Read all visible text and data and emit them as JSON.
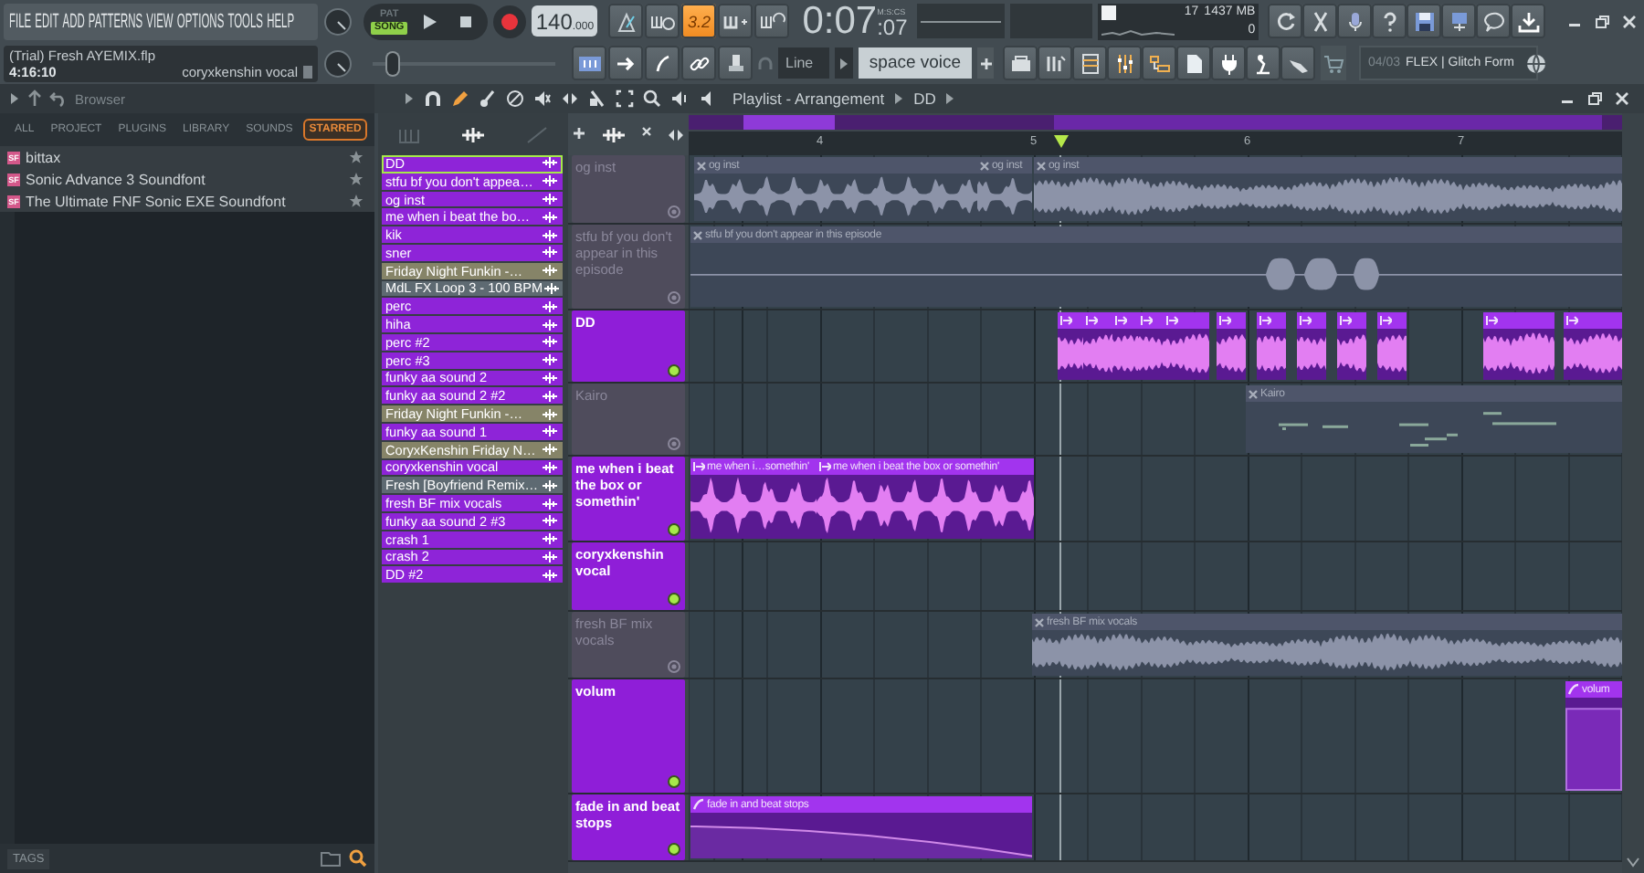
{
  "menu": [
    "FILE",
    "EDIT",
    "ADD",
    "PATTERNS",
    "VIEW",
    "OPTIONS",
    "TOOLS",
    "HELP"
  ],
  "transport": {
    "modes": [
      {
        "label": "PAT",
        "selected": false
      },
      {
        "label": "SONG",
        "selected": true
      }
    ]
  },
  "tempo": {
    "value": "140",
    "fraction": ".000"
  },
  "countdown": {
    "label": "3.2",
    "on": true
  },
  "time": {
    "display": "0:07",
    "centis": ":07",
    "unit": "M:S:CS"
  },
  "monitor": {
    "readings": [
      "17",
      "1437 MB",
      "0"
    ]
  },
  "hint": {
    "title": "(Trial) Fresh AYEMIX.flp",
    "position": "4:16:10",
    "channel": "coryxkenshin vocal"
  },
  "pitch": {
    "level": 0.08
  },
  "snap": {
    "value": "Line"
  },
  "pattern": {
    "value": "space voice"
  },
  "news": {
    "date": "04/03",
    "headline": "FLEX | Glitch Form"
  },
  "browser": {
    "title": "Browser",
    "tabs": [
      {
        "label": "ALL",
        "selected": false
      },
      {
        "label": "PROJECT",
        "selected": false
      },
      {
        "label": "PLUGINS",
        "selected": false
      },
      {
        "label": "LIBRARY",
        "selected": false
      },
      {
        "label": "SOUNDS",
        "selected": false
      },
      {
        "label": "STARRED",
        "selected": true
      }
    ],
    "items": [
      {
        "badge": "SF",
        "name": "bittax",
        "starred": true
      },
      {
        "badge": "SF",
        "name": "Sonic Advance 3 Soundfont",
        "starred": true
      },
      {
        "badge": "SF",
        "name": "The Ultimate FNF Sonic EXE Soundfont",
        "starred": true
      }
    ],
    "footer": "TAGS"
  },
  "playlist": {
    "title": "Playlist - Arrangement",
    "crumbs": [
      "DD"
    ],
    "channels": [
      {
        "name": "DD",
        "color": "#8e24d8",
        "selected": true
      },
      {
        "name": "stfu bf you don't appea…",
        "color": "#8e24d8",
        "selected": false
      },
      {
        "name": "og inst",
        "color": "#8e24d8",
        "selected": false
      },
      {
        "name": "me when i beat the bo…",
        "color": "#8e24d8",
        "selected": false
      },
      {
        "name": "kik",
        "color": "#8e24d8",
        "selected": false
      },
      {
        "name": "sner",
        "color": "#8e24d8",
        "selected": false
      },
      {
        "name": "Friday Night Funkin -…",
        "color": "#868468",
        "selected": false
      },
      {
        "name": "MdL FX Loop 3 - 100 BPM",
        "color": "#5e6a72",
        "selected": false
      },
      {
        "name": "perc",
        "color": "#8e24d8",
        "selected": false
      },
      {
        "name": "hiha",
        "color": "#8e24d8",
        "selected": false
      },
      {
        "name": "perc #2",
        "color": "#8e24d8",
        "selected": false
      },
      {
        "name": "perc #3",
        "color": "#8e24d8",
        "selected": false
      },
      {
        "name": "funky aa sound 2",
        "color": "#8e24d8",
        "selected": false
      },
      {
        "name": "funky aa sound 2 #2",
        "color": "#8e24d8",
        "selected": false
      },
      {
        "name": "Friday Night Funkin -…",
        "color": "#868468",
        "selected": false
      },
      {
        "name": "funky aa sound 1",
        "color": "#8e24d8",
        "selected": false
      },
      {
        "name": "CoryxKenshin Friday N…",
        "color": "#868468",
        "selected": false
      },
      {
        "name": "coryxkenshin vocal",
        "color": "#8e24d8",
        "selected": false
      },
      {
        "name": "Fresh [Boyfriend Remix…",
        "color": "#5e6a72",
        "selected": false
      },
      {
        "name": "fresh BF mix vocals",
        "color": "#8e24d8",
        "selected": false
      },
      {
        "name": "funky aa sound 2 #3",
        "color": "#8e24d8",
        "selected": false
      },
      {
        "name": "crash 1",
        "color": "#8e24d8",
        "selected": false
      },
      {
        "name": "crash 2",
        "color": "#8e24d8",
        "selected": false
      },
      {
        "name": "DD #2",
        "color": "#8e24d8",
        "selected": false
      }
    ],
    "ruler": [
      "4",
      "5",
      "6",
      "7"
    ],
    "tracks": [
      {
        "name": "og inst",
        "muted": true,
        "clips": [
          {
            "kind": "audio",
            "label": "og inst"
          },
          {
            "kind": "audio",
            "label": "og inst"
          },
          {
            "kind": "audio",
            "label": "og inst"
          }
        ]
      },
      {
        "name": "stfu bf you don't appear in this episode",
        "muted": true,
        "clips": [
          {
            "kind": "audio",
            "label": "stfu bf you don't appear in this episode"
          }
        ]
      },
      {
        "name": "DD",
        "muted": false,
        "clips": [
          {
            "kind": "slice"
          },
          {
            "kind": "slice"
          },
          {
            "kind": "slice"
          },
          {
            "kind": "slice"
          },
          {
            "kind": "slice"
          },
          {
            "kind": "slice"
          },
          {
            "kind": "slice"
          },
          {
            "kind": "slice"
          },
          {
            "kind": "slice"
          },
          {
            "kind": "slice"
          },
          {
            "kind": "slice"
          },
          {
            "kind": "slice"
          }
        ]
      },
      {
        "name": "Kairo",
        "muted": true,
        "clips": [
          {
            "kind": "pattern",
            "label": "Kairo"
          }
        ]
      },
      {
        "name": "me when i beat the box or somethin'",
        "muted": false,
        "clips": [
          {
            "kind": "audio",
            "label": "me when i…somethin'"
          },
          {
            "kind": "audio",
            "label": "me when i beat the box or somethin'"
          }
        ]
      },
      {
        "name": "coryxkenshin vocal",
        "muted": false
      },
      {
        "name": "fresh BF mix vocals",
        "muted": true,
        "clips": [
          {
            "kind": "audio",
            "label": "fresh BF mix vocals"
          }
        ]
      },
      {
        "name": "volum",
        "muted": false,
        "clips": [
          {
            "kind": "automation",
            "label": "volum"
          }
        ]
      },
      {
        "name": "fade in and beat stops",
        "muted": false,
        "clips": [
          {
            "kind": "automation",
            "label": "fade in and beat stops"
          }
        ]
      }
    ]
  }
}
